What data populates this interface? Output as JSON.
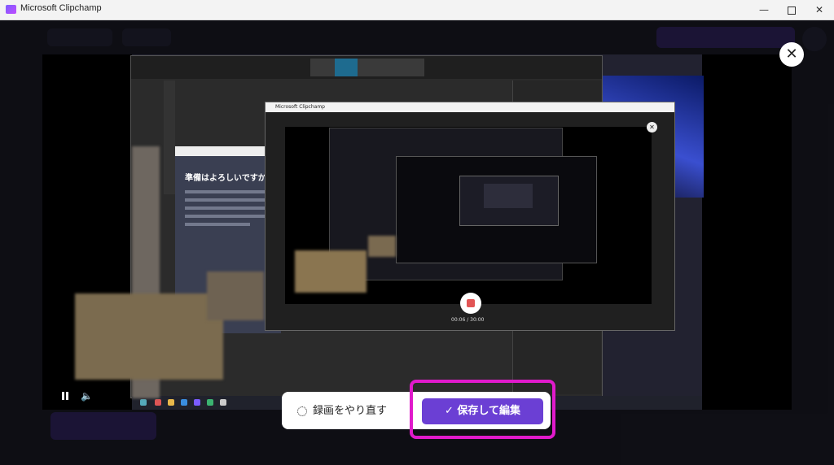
{
  "window": {
    "title": "Microsoft Clipchamp",
    "minimize": "—",
    "close": "✕"
  },
  "overlay": {
    "close_icon": "✕"
  },
  "recording": {
    "inner_window_title": "Microsoft Clipchamp",
    "inner_timer": "00:06 / 30:00",
    "slide_title": "準備はよろしいですか"
  },
  "controls": {
    "pause_icon": "pause-icon",
    "volume_icon": "🔈"
  },
  "actions": {
    "retake_label": "録画をやり直す",
    "save_label": "✓  保存して編集"
  },
  "colors": {
    "accent": "#6b3fd4",
    "highlight": "#e01acb"
  }
}
